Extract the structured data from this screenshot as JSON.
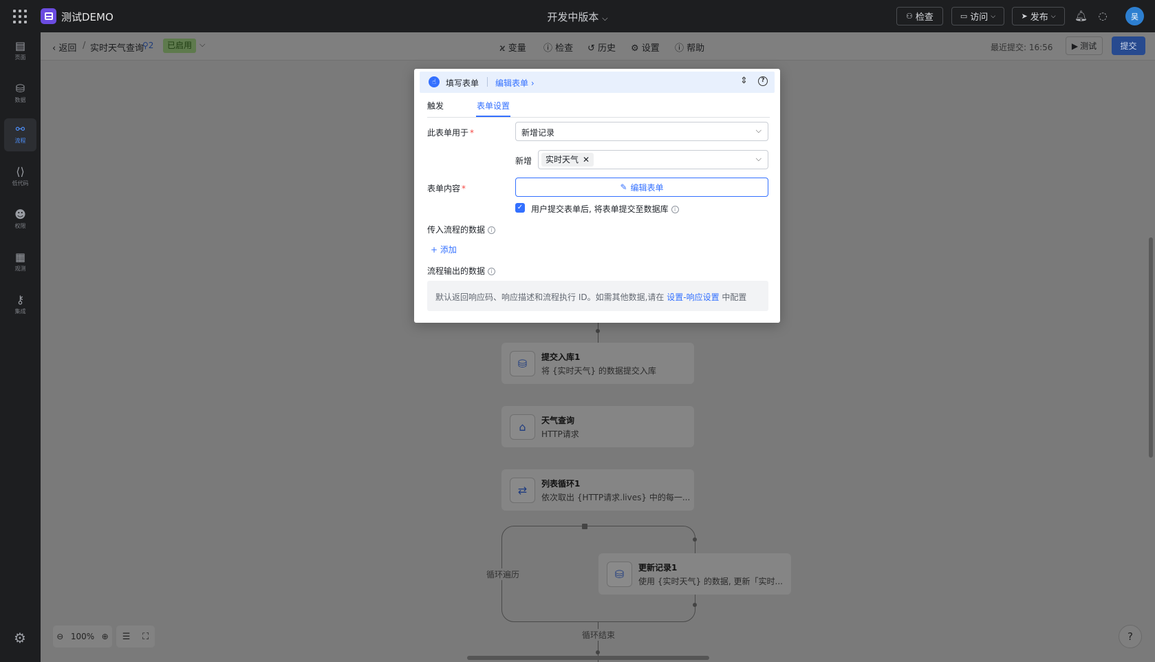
{
  "topbar": {
    "app_name": "测试DEMO",
    "version": "开发中版本",
    "inspect": "检查",
    "visit": "访问",
    "publish": "发布",
    "avatar": "吴"
  },
  "nav": {
    "items": [
      {
        "label": "页面",
        "icon": "pages-icon"
      },
      {
        "label": "数据",
        "icon": "database-icon"
      },
      {
        "label": "流程",
        "icon": "flow-icon"
      },
      {
        "label": "低代码",
        "icon": "code-icon"
      },
      {
        "label": "权限",
        "icon": "users-icon"
      },
      {
        "label": "观测",
        "icon": "monitor-icon"
      },
      {
        "label": "集成",
        "icon": "key-icon"
      }
    ],
    "active": "流程"
  },
  "subbar": {
    "back": "返回",
    "flow_name": "实时天气查询",
    "flow_version": "2",
    "status": "已启用",
    "tools": {
      "variables": "变量",
      "inspect": "检查",
      "history": "历史",
      "settings": "设置",
      "help": "帮助"
    },
    "last_submit_label": "最近提交: 16:56",
    "test": "测试",
    "submit": "提交"
  },
  "flow": {
    "nodes": [
      {
        "title": "提交入库1",
        "desc": "将 {实时天气} 的数据提交入库"
      },
      {
        "title": "天气查询",
        "desc": "HTTP请求"
      },
      {
        "title": "列表循环1",
        "desc": "依次取出 {HTTP请求.lives} 中的每一..."
      },
      {
        "title": "更新记录1",
        "desc": "使用 {实时天气} 的数据, 更新「实时..."
      }
    ],
    "loop_traverse": "循环遍历",
    "loop_end": "循环结束"
  },
  "zoom": {
    "level": "100%"
  },
  "modal": {
    "title": "填写表单",
    "edit_link": "编辑表单",
    "tabs": [
      "触发",
      "表单设置"
    ],
    "active_tab": "表单设置",
    "form_usage_label": "此表单用于",
    "form_usage_value": "新增记录",
    "add_label": "新增",
    "add_tag": "实时天气",
    "form_content_label": "表单内容",
    "edit_form_button": "编辑表单",
    "checkbox_text": "用户提交表单后, 将表单提交至数据库",
    "checkbox_checked": true,
    "input_data_label": "传入流程的数据",
    "add_button": "添加",
    "output_data_label": "流程输出的数据",
    "output_note_prefix": "默认返回响应码、响应描述和流程执行 ID。如需其他数据,请在",
    "output_note_link": "设置-响应设置",
    "output_note_suffix": "中配置"
  },
  "colors": {
    "accent": "#3370ff",
    "required": "#f54a45",
    "sidebar_bg": "#1d1e20"
  }
}
